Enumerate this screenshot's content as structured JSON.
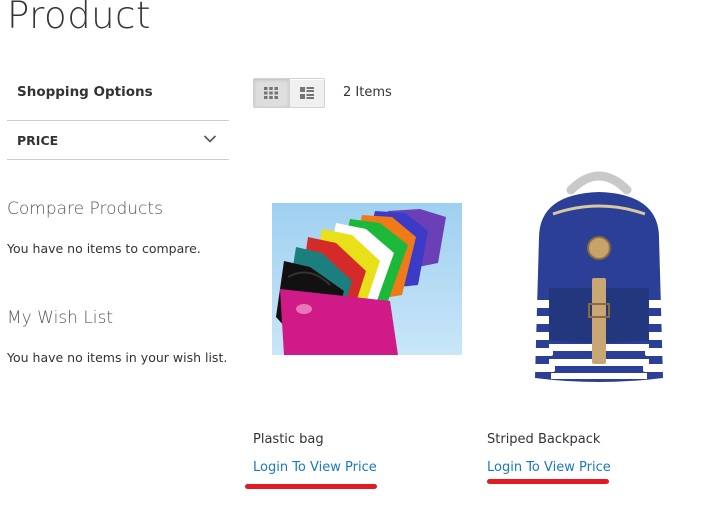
{
  "page": {
    "title": "Product"
  },
  "sidebar": {
    "shopping_options": "Shopping Options",
    "filter": {
      "label": "PRICE",
      "icon": "chevron-down-icon"
    },
    "compare": {
      "title": "Compare Products",
      "empty": "You have no items to compare."
    },
    "wishlist": {
      "title": "My Wish List",
      "empty": "You have no items in your wish list."
    }
  },
  "toolbar": {
    "modes": [
      {
        "icon": "grid-view-icon",
        "active": true
      },
      {
        "icon": "list-view-icon",
        "active": false
      }
    ],
    "amount": "2 Items"
  },
  "products": [
    {
      "name": "Plastic bag",
      "price_link": "Login To View Price",
      "image_icon": "plastic-bags-image"
    },
    {
      "name": "Striped Backpack",
      "price_link": "Login To View Price",
      "image_icon": "striped-backpack-image"
    }
  ],
  "colors": {
    "link": "#1979c3",
    "annotation_underline": "#e01b24",
    "text": "#333333"
  }
}
